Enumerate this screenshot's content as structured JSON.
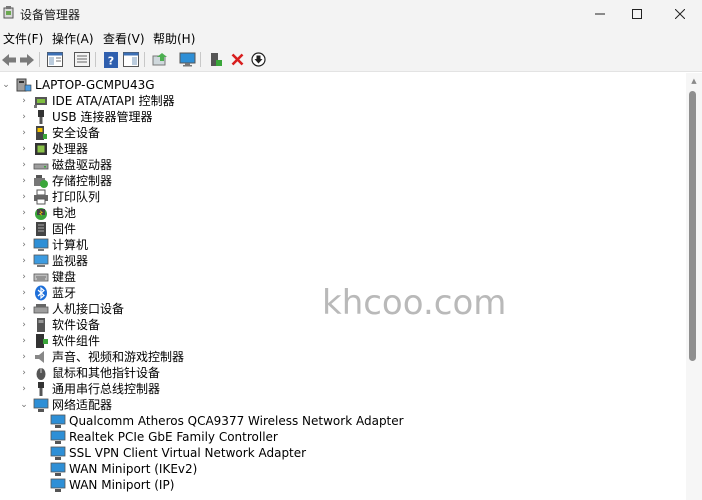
{
  "window": {
    "title": "设备管理器",
    "controls": {
      "minimize": "—",
      "maximize": "☐",
      "close": "✕"
    }
  },
  "menu": [
    {
      "label": "文件(F)"
    },
    {
      "label": "操作(A)"
    },
    {
      "label": "查看(V)"
    },
    {
      "label": "帮助(H)"
    }
  ],
  "toolbar": {
    "buttons": [
      "back-arrow",
      "forward-arrow",
      "properties",
      "console-tree",
      "help",
      "action-view",
      "update-driver",
      "scan-hardware",
      "add-driver",
      "uninstall-device",
      "disable-device"
    ]
  },
  "tree": {
    "root": "LAPTOP-GCMPU43G",
    "categories": [
      {
        "label": "IDE ATA/ATAPI 控制器",
        "icon": "ide-controller-icon"
      },
      {
        "label": "USB 连接器管理器",
        "icon": "usb-icon"
      },
      {
        "label": "安全设备",
        "icon": "security-device-icon"
      },
      {
        "label": "处理器",
        "icon": "processor-icon"
      },
      {
        "label": "磁盘驱动器",
        "icon": "disk-drive-icon"
      },
      {
        "label": "存储控制器",
        "icon": "storage-controller-icon"
      },
      {
        "label": "打印队列",
        "icon": "printer-icon"
      },
      {
        "label": "电池",
        "icon": "battery-icon"
      },
      {
        "label": "固件",
        "icon": "firmware-icon"
      },
      {
        "label": "计算机",
        "icon": "computer-icon"
      },
      {
        "label": "监视器",
        "icon": "monitor-icon"
      },
      {
        "label": "键盘",
        "icon": "keyboard-icon"
      },
      {
        "label": "蓝牙",
        "icon": "bluetooth-icon"
      },
      {
        "label": "人机接口设备",
        "icon": "hid-icon"
      },
      {
        "label": "软件设备",
        "icon": "software-device-icon"
      },
      {
        "label": "软件组件",
        "icon": "software-component-icon"
      },
      {
        "label": "声音、视频和游戏控制器",
        "icon": "speaker-icon"
      },
      {
        "label": "鼠标和其他指针设备",
        "icon": "mouse-icon"
      },
      {
        "label": "通用串行总线控制器",
        "icon": "usb-controller-icon"
      },
      {
        "label": "网络适配器",
        "icon": "network-adapter-icon",
        "expanded": true
      }
    ],
    "network_adapters": [
      {
        "label": "Qualcomm Atheros QCA9377 Wireless Network Adapter"
      },
      {
        "label": "Realtek PCIe GbE Family Controller"
      },
      {
        "label": "SSL VPN Client Virtual Network Adapter"
      },
      {
        "label": "WAN Miniport (IKEv2)"
      },
      {
        "label": "WAN Miniport (IP)"
      }
    ]
  },
  "watermark": "khcoo.com",
  "colors": {
    "chrome": "#f3f3f3",
    "accent_blue": "#1e8ad6",
    "uninstall_red": "#d81e1e",
    "scrollbar_thumb": "#8f8f8f"
  }
}
